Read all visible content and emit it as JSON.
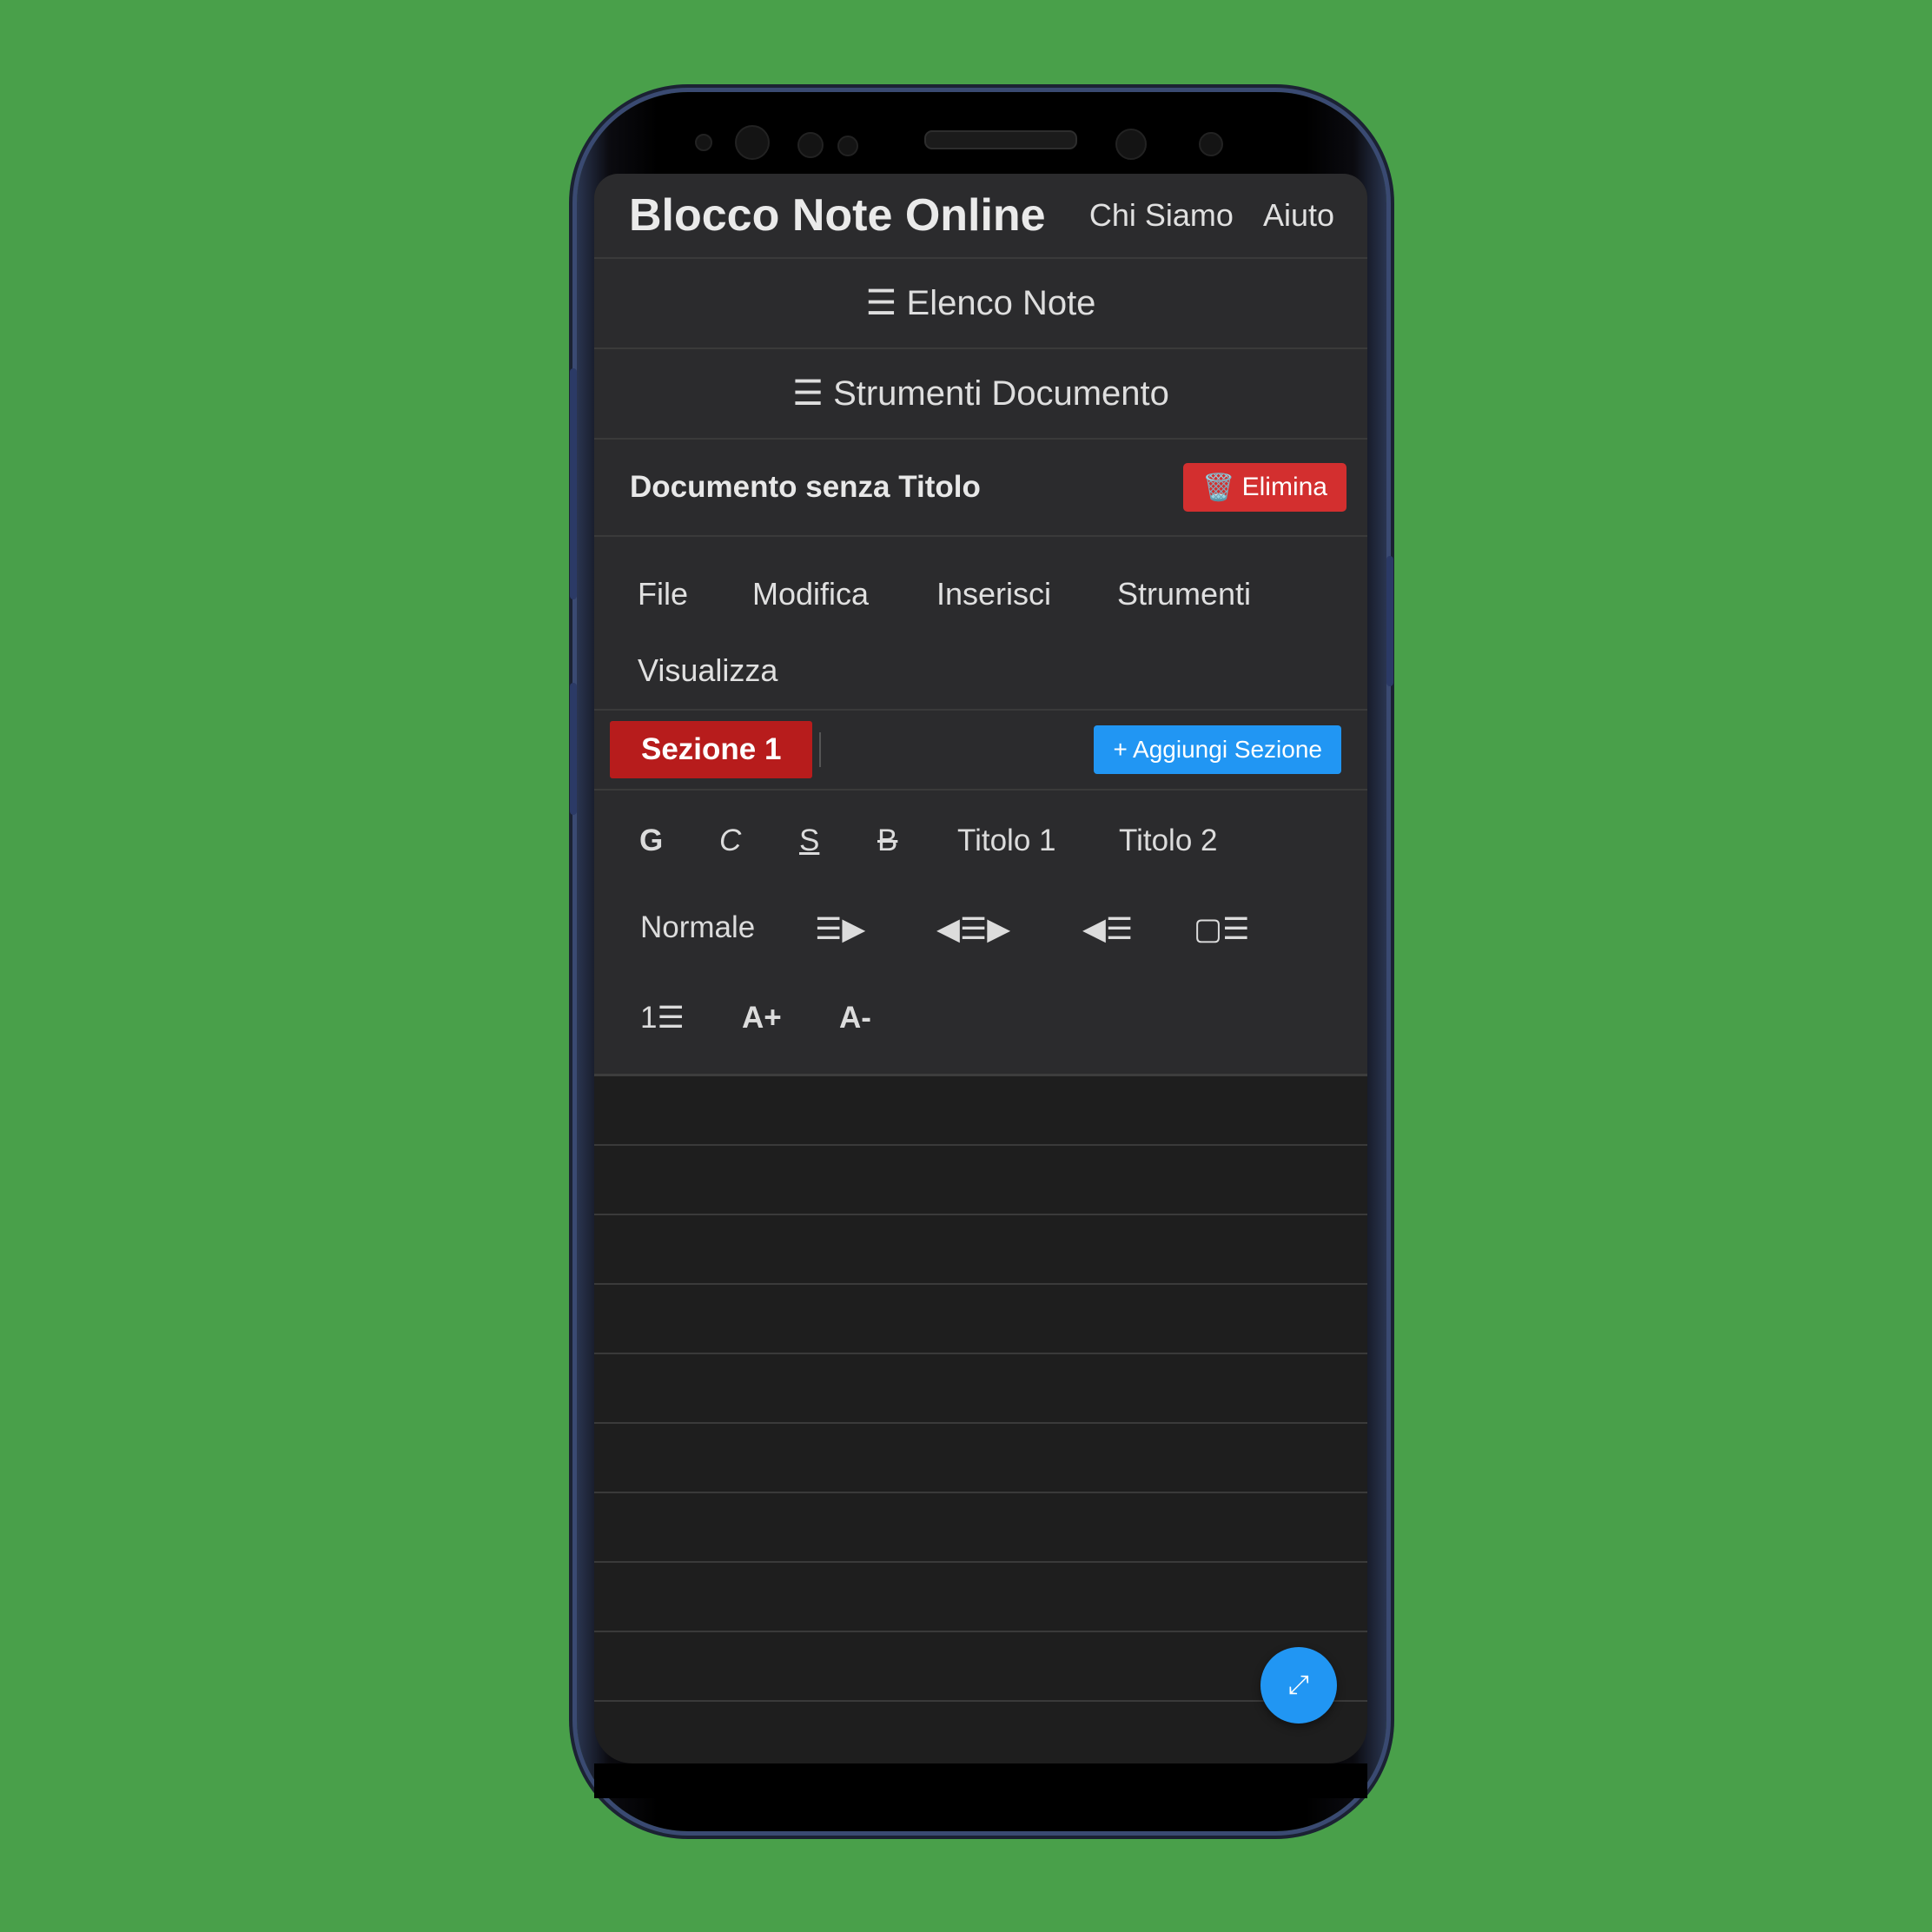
{
  "header": {
    "brand": "Blocco Note Online",
    "links": [
      "Chi Siamo",
      "Aiuto"
    ]
  },
  "bars": {
    "notes_list": "☰ Elenco Note",
    "doc_tools": "☰ Strumenti Documento"
  },
  "document": {
    "title": "Documento senza Titolo",
    "delete_icon": "🗑️",
    "delete_label": "Elimina"
  },
  "menu": [
    "File",
    "Modifica",
    "Inserisci",
    "Strumenti",
    "Visualizza"
  ],
  "sections": {
    "tabs": [
      "Sezione 1"
    ],
    "add_label": "+ Aggiungi Sezione"
  },
  "toolbar": {
    "bold": "G",
    "italic": "C",
    "underline": "S",
    "strike": "B",
    "heading1": "Titolo 1",
    "heading2": "Titolo 2",
    "normal": "Normale",
    "align_left": "☰▶",
    "align_center": "◀☰▶",
    "align_right": "◀☰",
    "bullet_list": "▢☰",
    "numbered_list": "1☰",
    "font_increase": "A+",
    "font_decrease": "A-"
  },
  "fab": {
    "icon": "expand-icon",
    "glyph": "⤢"
  },
  "colors": {
    "background": "#49a04a",
    "delete": "#d32f2f",
    "section_tab": "#b71c1c",
    "accent": "#2196f3"
  }
}
